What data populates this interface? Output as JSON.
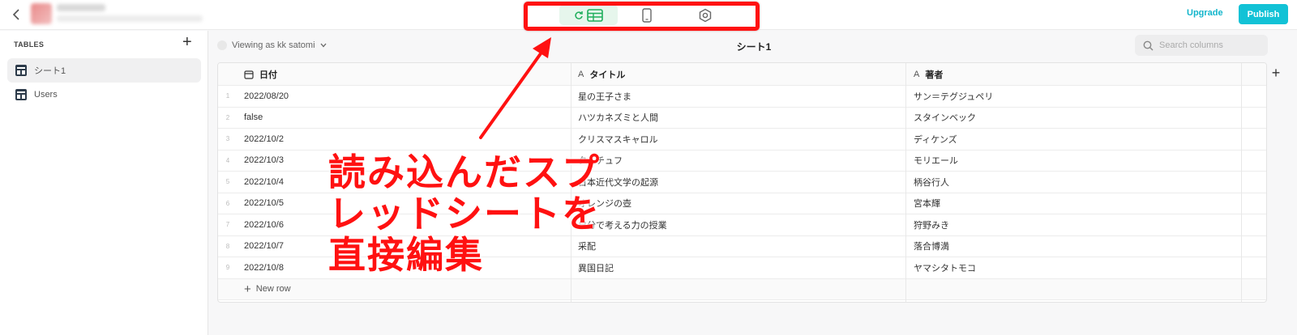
{
  "topbar": {
    "upgrade_label": "Upgrade",
    "publish_label": "Publish"
  },
  "sidebar": {
    "header": "TABLES",
    "items": [
      {
        "label": "シート1"
      },
      {
        "label": "Users"
      }
    ]
  },
  "viewing_as": "Viewing as kk satomi",
  "sheet_title": "シート1",
  "search": {
    "placeholder": "Search columns"
  },
  "columns": [
    {
      "label": "日付",
      "icon": "calendar-icon"
    },
    {
      "label": "タイトル",
      "icon": "text-icon"
    },
    {
      "label": "著者",
      "icon": "text-icon"
    }
  ],
  "rows": [
    {
      "num": "1",
      "date": "2022/08/20",
      "title": "星の王子さま",
      "author": "サン＝テグジュペリ"
    },
    {
      "num": "2",
      "date": "false",
      "title": "ハツカネズミと人間",
      "author": "スタインベック"
    },
    {
      "num": "3",
      "date": "2022/10/2",
      "title": "クリスマスキャロル",
      "author": "ディケンズ"
    },
    {
      "num": "4",
      "date": "2022/10/3",
      "title": "タルチュフ",
      "author": "モリエール"
    },
    {
      "num": "5",
      "date": "2022/10/4",
      "title": "日本近代文学の起源",
      "author": "柄谷行人"
    },
    {
      "num": "6",
      "date": "2022/10/5",
      "title": "オレンジの壺",
      "author": "宮本輝"
    },
    {
      "num": "7",
      "date": "2022/10/6",
      "title": "自分で考える力の授業",
      "author": "狩野みき"
    },
    {
      "num": "8",
      "date": "2022/10/7",
      "title": "采配",
      "author": "落合博満"
    },
    {
      "num": "9",
      "date": "2022/10/8",
      "title": "異国日記",
      "author": "ヤマシタトモコ"
    }
  ],
  "new_row_label": "New row",
  "annotation": {
    "line1": "読み込んだスプ",
    "line2": "レッドシートを",
    "line3": "直接編集"
  },
  "colors": {
    "accent": "#12c2d6",
    "annotation": "#ff1111",
    "active_mode": "#1fae5b"
  }
}
